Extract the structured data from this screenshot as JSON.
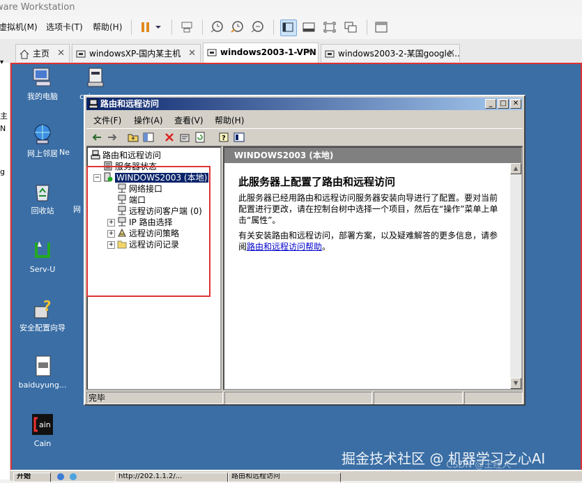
{
  "vm": {
    "title": "ware Workstation",
    "menus": [
      "虚拟机(M)",
      "选项卡(T)",
      "帮助(H)"
    ],
    "tabs": [
      {
        "label": "主页",
        "active": false
      },
      {
        "label": "windowsXP-国内某主机",
        "active": false
      },
      {
        "label": "windows2003-1-VPN",
        "active": true
      },
      {
        "label": "windows2003-2-某国google...",
        "active": false
      }
    ],
    "left_strip_fragments": [
      "主",
      "N",
      "g"
    ]
  },
  "desktop": {
    "icons": [
      {
        "label": "我的电脑",
        "icon": "my-computer-icon"
      },
      {
        "label": "cain.exe",
        "icon": "installer-icon"
      },
      {
        "label": "网上邻居",
        "icon": "network-places-icon"
      },
      {
        "label": "Ne",
        "icon": "partial-icon"
      },
      {
        "label": "回收站",
        "icon": "recycle-bin-icon"
      },
      {
        "label": "网",
        "icon": "partial-icon"
      },
      {
        "label": "Serv-U",
        "icon": "servu-icon"
      },
      {
        "label": "安全配置向导",
        "icon": "security-wizard-icon"
      },
      {
        "label": "baiduyung...",
        "icon": "document-icon"
      },
      {
        "label": "Cain",
        "icon": "cain-icon"
      }
    ]
  },
  "window": {
    "title": "路由和远程访问",
    "menu": [
      "文件(F)",
      "操作(A)",
      "查看(V)",
      "帮助(H)"
    ],
    "tree": {
      "root": "路由和远程访问",
      "server_status": "服务器状态",
      "server": "WINDOWS2003 (本地)",
      "children": [
        "网络接口",
        "端口",
        "远程访问客户端 (0)",
        "IP 路由选择",
        "远程访问策略",
        "远程访问记录"
      ]
    },
    "right": {
      "header": "WINDOWS2003 (本地)",
      "heading": "此服务器上配置了路由和远程访问",
      "para1": "此服务器已经用路由和远程访问服务器安装向导进行了配置。要对当前配置进行更改，请在控制台树中选择一个项目，然后在“操作”菜单上单击“属性”。",
      "para2_prefix": "有关安装路由和远程访问，部署方案，以及疑难解答的更多信息，请参阅",
      "para2_link": "路由和远程访问帮助",
      "para2_suffix": "。"
    },
    "status": "完毕"
  },
  "taskbar": {
    "start": "开始",
    "tasks": [
      "http://202.1.1.2/...",
      "路由和远程访问"
    ]
  },
  "watermark": {
    "main": "掘金技术社区 @ 机器学习之心AI",
    "sub": "CSDN @王经人"
  },
  "colors": {
    "accent_red": "#d33333",
    "desktop_blue": "#3a6ea5",
    "titlebar_start": "#0a246a",
    "titlebar_end": "#a6caf0"
  }
}
